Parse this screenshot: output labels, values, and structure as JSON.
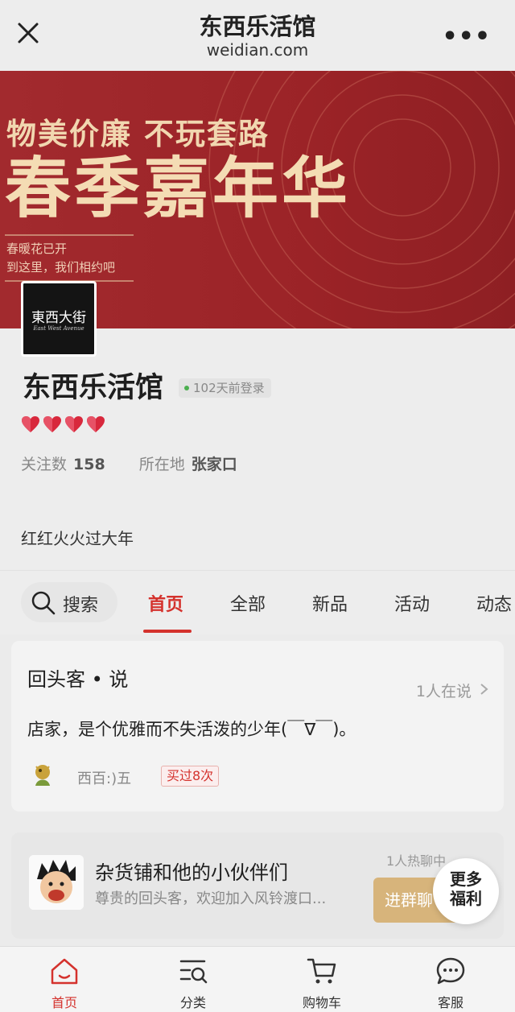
{
  "topbar": {
    "title": "东西乐活馆",
    "domain": "weidian.com",
    "close_icon": "close-icon",
    "more_icon": "more-icon"
  },
  "banner": {
    "slogan": "物美价廉 不玩套路",
    "headline": "春季嘉年华",
    "subline1": "春暖花已开",
    "subline2": "到这里，我们相约吧"
  },
  "shop": {
    "logo_cn": "東西大街",
    "logo_en": "East West Avenue",
    "name": "东西乐活馆",
    "login_status": "102天前登录",
    "hearts": 4,
    "followers_label": "关注数",
    "followers": "158",
    "location_label": "所在地",
    "location": "张家口",
    "description": "红红火火过大年"
  },
  "tabs": {
    "search_label": "搜索",
    "items": [
      "首页",
      "全部",
      "新品",
      "活动",
      "动态"
    ],
    "active": "首页"
  },
  "review": {
    "title": "回头客 • 说",
    "talking": "1人在说",
    "text": "店家，是个优雅而不失活泼的少年(￣∇￣)。",
    "user": "西百:)五",
    "badge": "买过8次"
  },
  "group": {
    "name": "杂货铺和他的小伙伴们",
    "subtitle": "尊贵的回头客，欢迎加入风铃渡口...",
    "hot": "1人热聊中",
    "join_label": "进群聊",
    "bubble_line1": "更多",
    "bubble_line2": "福利"
  },
  "bottomnav": {
    "items": [
      "首页",
      "分类",
      "购物车",
      "客服"
    ],
    "icons": [
      "home-icon",
      "category-icon",
      "cart-icon",
      "service-icon"
    ],
    "active": "首页"
  },
  "colors": {
    "accent": "#d4322d",
    "banner_red": "#9b2327",
    "banner_gold": "#f4dcb4",
    "join_gold": "#d7b47b"
  }
}
